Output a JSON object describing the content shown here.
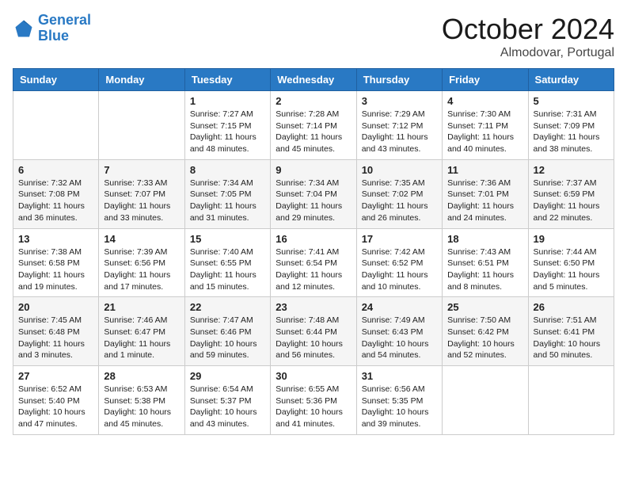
{
  "header": {
    "logo_text_general": "General",
    "logo_text_blue": "Blue",
    "month": "October 2024",
    "location": "Almodovar, Portugal"
  },
  "weekdays": [
    "Sunday",
    "Monday",
    "Tuesday",
    "Wednesday",
    "Thursday",
    "Friday",
    "Saturday"
  ],
  "weeks": [
    [
      {
        "day": "",
        "info": ""
      },
      {
        "day": "",
        "info": ""
      },
      {
        "day": "1",
        "info": "Sunrise: 7:27 AM\nSunset: 7:15 PM\nDaylight: 11 hours and 48 minutes."
      },
      {
        "day": "2",
        "info": "Sunrise: 7:28 AM\nSunset: 7:14 PM\nDaylight: 11 hours and 45 minutes."
      },
      {
        "day": "3",
        "info": "Sunrise: 7:29 AM\nSunset: 7:12 PM\nDaylight: 11 hours and 43 minutes."
      },
      {
        "day": "4",
        "info": "Sunrise: 7:30 AM\nSunset: 7:11 PM\nDaylight: 11 hours and 40 minutes."
      },
      {
        "day": "5",
        "info": "Sunrise: 7:31 AM\nSunset: 7:09 PM\nDaylight: 11 hours and 38 minutes."
      }
    ],
    [
      {
        "day": "6",
        "info": "Sunrise: 7:32 AM\nSunset: 7:08 PM\nDaylight: 11 hours and 36 minutes."
      },
      {
        "day": "7",
        "info": "Sunrise: 7:33 AM\nSunset: 7:07 PM\nDaylight: 11 hours and 33 minutes."
      },
      {
        "day": "8",
        "info": "Sunrise: 7:34 AM\nSunset: 7:05 PM\nDaylight: 11 hours and 31 minutes."
      },
      {
        "day": "9",
        "info": "Sunrise: 7:34 AM\nSunset: 7:04 PM\nDaylight: 11 hours and 29 minutes."
      },
      {
        "day": "10",
        "info": "Sunrise: 7:35 AM\nSunset: 7:02 PM\nDaylight: 11 hours and 26 minutes."
      },
      {
        "day": "11",
        "info": "Sunrise: 7:36 AM\nSunset: 7:01 PM\nDaylight: 11 hours and 24 minutes."
      },
      {
        "day": "12",
        "info": "Sunrise: 7:37 AM\nSunset: 6:59 PM\nDaylight: 11 hours and 22 minutes."
      }
    ],
    [
      {
        "day": "13",
        "info": "Sunrise: 7:38 AM\nSunset: 6:58 PM\nDaylight: 11 hours and 19 minutes."
      },
      {
        "day": "14",
        "info": "Sunrise: 7:39 AM\nSunset: 6:56 PM\nDaylight: 11 hours and 17 minutes."
      },
      {
        "day": "15",
        "info": "Sunrise: 7:40 AM\nSunset: 6:55 PM\nDaylight: 11 hours and 15 minutes."
      },
      {
        "day": "16",
        "info": "Sunrise: 7:41 AM\nSunset: 6:54 PM\nDaylight: 11 hours and 12 minutes."
      },
      {
        "day": "17",
        "info": "Sunrise: 7:42 AM\nSunset: 6:52 PM\nDaylight: 11 hours and 10 minutes."
      },
      {
        "day": "18",
        "info": "Sunrise: 7:43 AM\nSunset: 6:51 PM\nDaylight: 11 hours and 8 minutes."
      },
      {
        "day": "19",
        "info": "Sunrise: 7:44 AM\nSunset: 6:50 PM\nDaylight: 11 hours and 5 minutes."
      }
    ],
    [
      {
        "day": "20",
        "info": "Sunrise: 7:45 AM\nSunset: 6:48 PM\nDaylight: 11 hours and 3 minutes."
      },
      {
        "day": "21",
        "info": "Sunrise: 7:46 AM\nSunset: 6:47 PM\nDaylight: 11 hours and 1 minute."
      },
      {
        "day": "22",
        "info": "Sunrise: 7:47 AM\nSunset: 6:46 PM\nDaylight: 10 hours and 59 minutes."
      },
      {
        "day": "23",
        "info": "Sunrise: 7:48 AM\nSunset: 6:44 PM\nDaylight: 10 hours and 56 minutes."
      },
      {
        "day": "24",
        "info": "Sunrise: 7:49 AM\nSunset: 6:43 PM\nDaylight: 10 hours and 54 minutes."
      },
      {
        "day": "25",
        "info": "Sunrise: 7:50 AM\nSunset: 6:42 PM\nDaylight: 10 hours and 52 minutes."
      },
      {
        "day": "26",
        "info": "Sunrise: 7:51 AM\nSunset: 6:41 PM\nDaylight: 10 hours and 50 minutes."
      }
    ],
    [
      {
        "day": "27",
        "info": "Sunrise: 6:52 AM\nSunset: 5:40 PM\nDaylight: 10 hours and 47 minutes."
      },
      {
        "day": "28",
        "info": "Sunrise: 6:53 AM\nSunset: 5:38 PM\nDaylight: 10 hours and 45 minutes."
      },
      {
        "day": "29",
        "info": "Sunrise: 6:54 AM\nSunset: 5:37 PM\nDaylight: 10 hours and 43 minutes."
      },
      {
        "day": "30",
        "info": "Sunrise: 6:55 AM\nSunset: 5:36 PM\nDaylight: 10 hours and 41 minutes."
      },
      {
        "day": "31",
        "info": "Sunrise: 6:56 AM\nSunset: 5:35 PM\nDaylight: 10 hours and 39 minutes."
      },
      {
        "day": "",
        "info": ""
      },
      {
        "day": "",
        "info": ""
      }
    ]
  ]
}
